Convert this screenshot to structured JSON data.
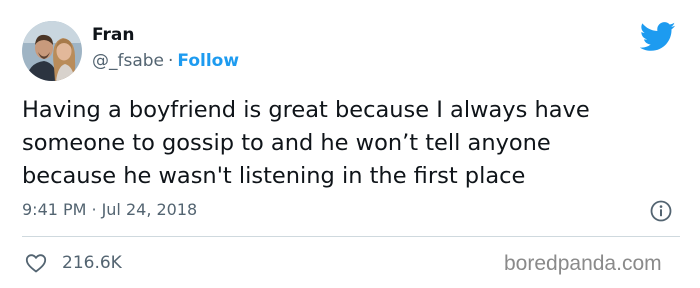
{
  "author": {
    "display_name": "Fran",
    "handle": "@_fsabe",
    "separator": "·",
    "follow_label": "Follow"
  },
  "tweet": {
    "lines": [
      "Having a boyfriend is great because I always have",
      "someone to gossip to and he won’t tell anyone",
      "because he wasn't listening in the first place"
    ],
    "time": "9:41 PM",
    "separator": "·",
    "date": "Jul 24, 2018"
  },
  "stats": {
    "likes": "216.6K"
  },
  "watermark": "boredpanda.com",
  "icons": {
    "brand": "twitter-bird-icon",
    "info": "info-icon",
    "like": "heart-icon"
  },
  "colors": {
    "brand_blue": "#1d9bf0",
    "text_primary": "#0f1419",
    "text_secondary": "#536471",
    "divider": "#cfd9de"
  }
}
